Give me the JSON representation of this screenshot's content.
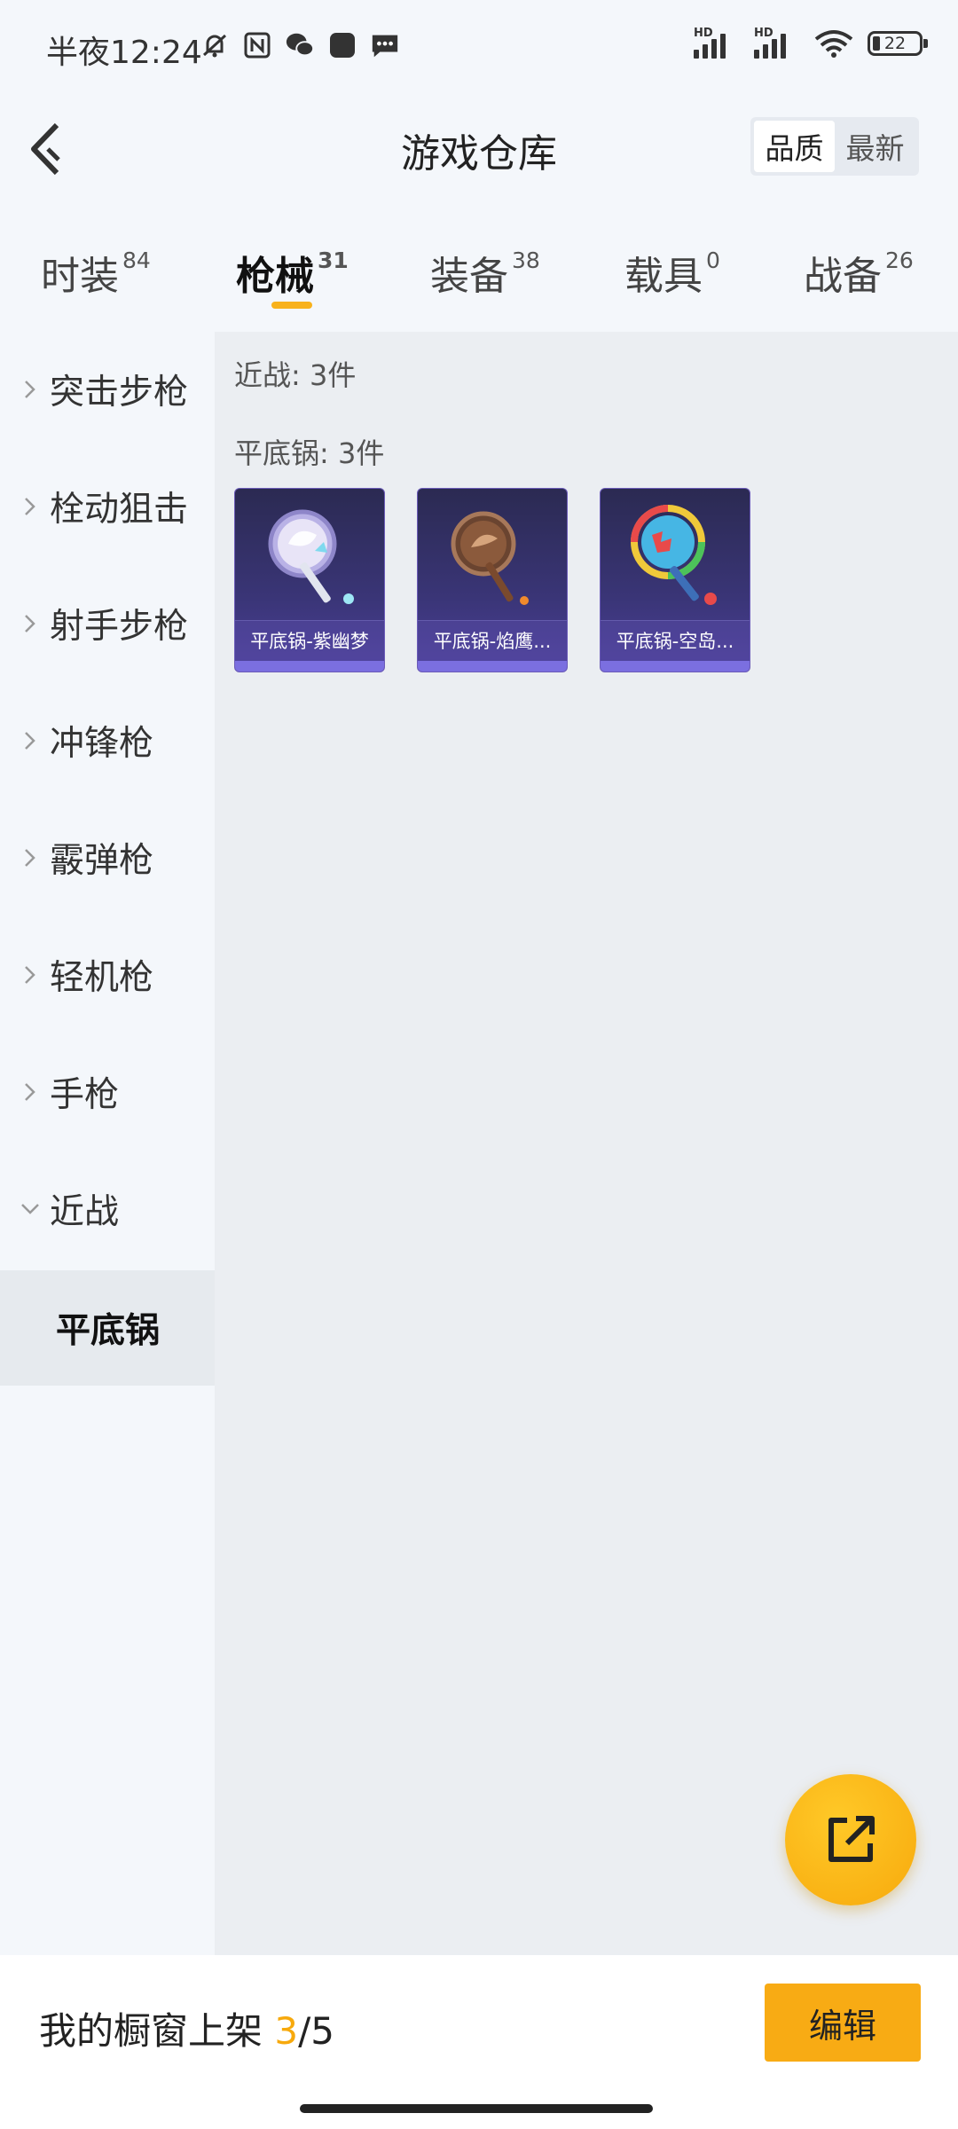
{
  "status_bar": {
    "time": "半夜12:24",
    "battery": "22",
    "signal_label": "HD"
  },
  "header": {
    "title": "游戏仓库",
    "sort_options": [
      "品质",
      "最新"
    ],
    "sort_selected": "品质"
  },
  "tabs": [
    {
      "label": "时装",
      "count": "84"
    },
    {
      "label": "枪械",
      "count": "31",
      "active": true
    },
    {
      "label": "装备",
      "count": "38"
    },
    {
      "label": "载具",
      "count": "0"
    },
    {
      "label": "战备",
      "count": "26"
    }
  ],
  "sidebar": {
    "items": [
      {
        "label": "突击步枪",
        "expanded": false
      },
      {
        "label": "栓动狙击",
        "expanded": false
      },
      {
        "label": "射手步枪",
        "expanded": false
      },
      {
        "label": "冲锋枪",
        "expanded": false
      },
      {
        "label": "霰弹枪",
        "expanded": false
      },
      {
        "label": "轻机枪",
        "expanded": false
      },
      {
        "label": "手枪",
        "expanded": false
      },
      {
        "label": "近战",
        "expanded": true
      }
    ],
    "selected_sub": "平底锅"
  },
  "content": {
    "category_count_label": "近战: 3件",
    "subcategory_count_label": "平底锅: 3件",
    "items": [
      {
        "name": "平底锅-紫幽梦",
        "icon": "pan-purple-dream"
      },
      {
        "name": "平底锅-焰鹰...",
        "icon": "pan-flame-eagle"
      },
      {
        "name": "平底锅-空岛...",
        "icon": "pan-sky-island"
      }
    ]
  },
  "bottom_bar": {
    "label": "我的橱窗上架",
    "current": "3",
    "total": "/5",
    "edit_label": "编辑"
  },
  "colors": {
    "accent": "#f8ab14",
    "card_bg": "#3a3577",
    "page_bg": "#f4f7fb",
    "content_bg": "#ebeef2"
  }
}
